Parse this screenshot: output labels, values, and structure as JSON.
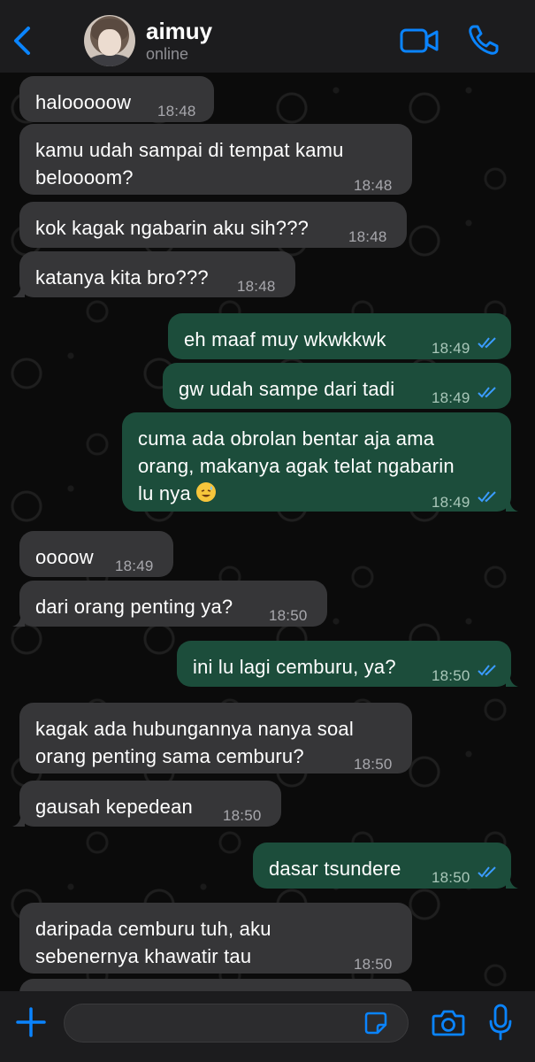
{
  "header": {
    "contact_name": "aimuy",
    "contact_status": "online",
    "icons": [
      "chevron-left-icon",
      "video-camera-icon",
      "phone-icon"
    ],
    "accent_color": "#0a84ff"
  },
  "messages": [
    {
      "dir": "in",
      "text": "halooooow",
      "time": "18:48"
    },
    {
      "dir": "in",
      "text": "kamu udah sampai di tempat kamu\nbeloooom?",
      "time": "18:48"
    },
    {
      "dir": "in",
      "text": "kok kagak ngabarin aku sih???",
      "time": "18:48"
    },
    {
      "dir": "in",
      "text": "katanya kita bro???",
      "time": "18:48"
    },
    {
      "dir": "out",
      "text": "eh maaf muy wkwkkwk",
      "time": "18:49",
      "status": "read"
    },
    {
      "dir": "out",
      "text": "gw udah sampe dari tadi",
      "time": "18:49",
      "status": "read"
    },
    {
      "dir": "out",
      "text": "cuma ada obrolan bentar aja ama\norang, makanya agak telat ngabarin\nlu nya",
      "emoji": "sweat-smile",
      "time": "18:49",
      "status": "read"
    },
    {
      "dir": "in",
      "text": "oooow",
      "time": "18:49"
    },
    {
      "dir": "in",
      "text": "dari orang penting ya?",
      "time": "18:50"
    },
    {
      "dir": "out",
      "text": "ini lu lagi cemburu, ya?",
      "time": "18:50",
      "status": "read"
    },
    {
      "dir": "in",
      "text": "kagak ada hubungannya nanya soal\norang penting sama cemburu?",
      "time": "18:50"
    },
    {
      "dir": "in",
      "text": "gausah kepedean",
      "time": "18:50"
    },
    {
      "dir": "out",
      "text": "dasar tsundere",
      "time": "18:50",
      "status": "read"
    },
    {
      "dir": "in",
      "text": "daripada cemburu tuh, aku\nsebenernya khawatir tau",
      "time": "18:50"
    }
  ],
  "composer": {
    "placeholder": "",
    "icons": [
      "plus-icon",
      "sticker-icon",
      "camera-icon",
      "microphone-icon"
    ]
  },
  "colors": {
    "incoming_bubble": "#363638",
    "outgoing_bubble": "#1c4d3b",
    "read_ticks": "#3b9cff"
  }
}
